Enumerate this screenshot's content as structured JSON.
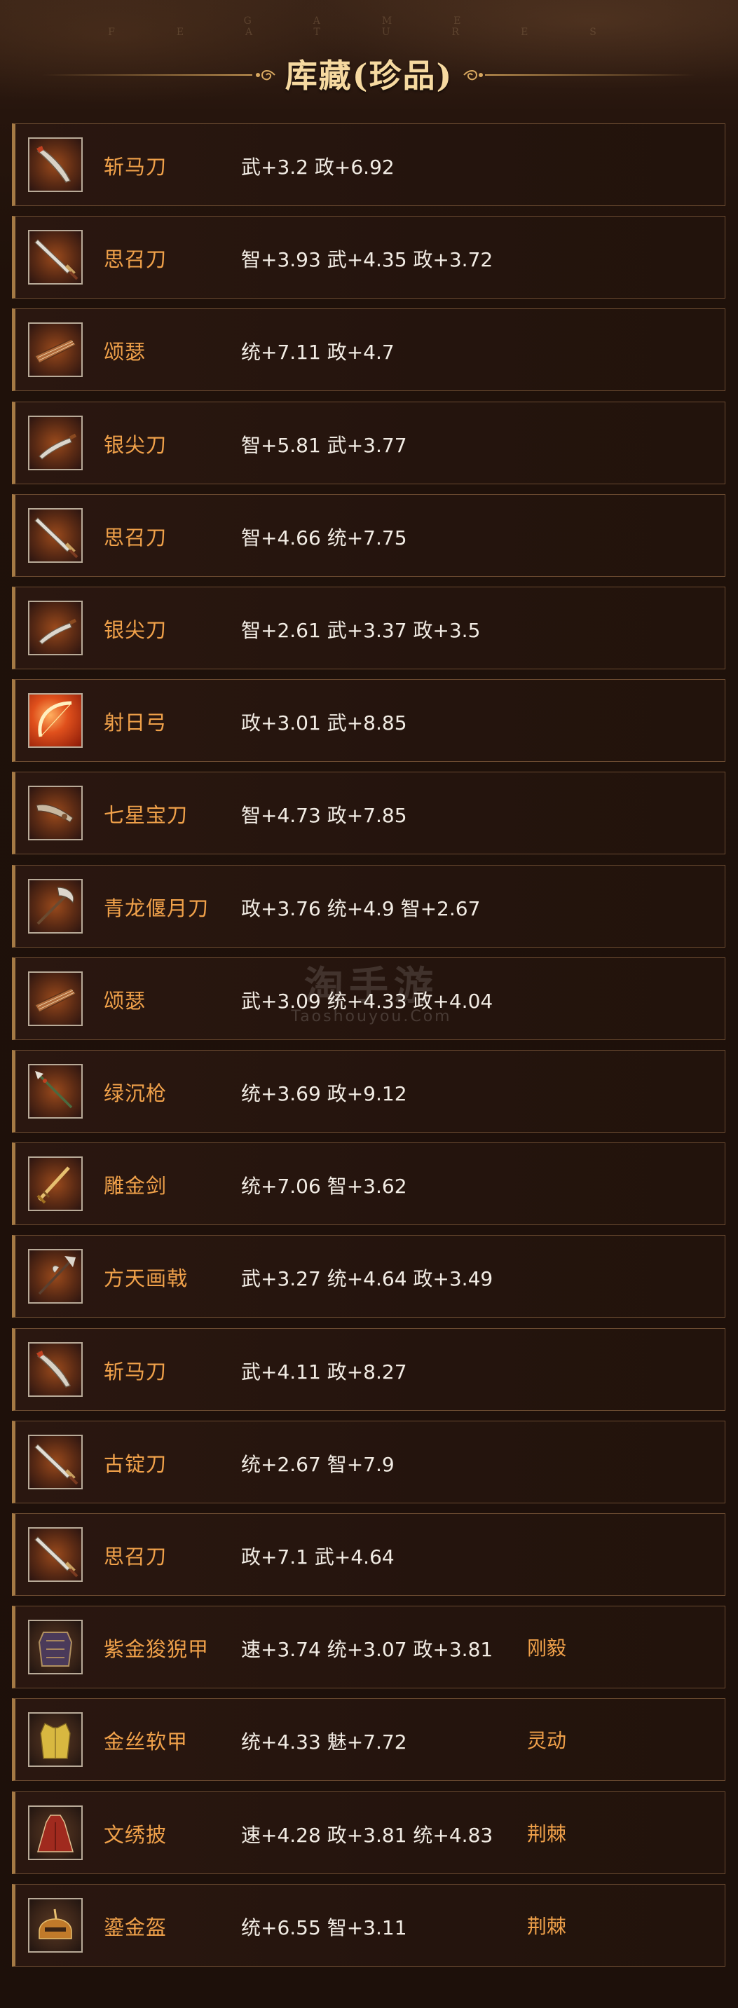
{
  "header": {
    "subtitle": "GAME FEATURES",
    "title": "库藏(珍品)"
  },
  "watermark": {
    "cn": "淘手游",
    "en": "Taoshouyou.Com"
  },
  "items": [
    {
      "name": "斩马刀",
      "stats": "武+3.2 政+6.92",
      "trait": "",
      "icon": "blade-icon"
    },
    {
      "name": "思召刀",
      "stats": "智+3.93 武+4.35 政+3.72",
      "trait": "",
      "icon": "sword-icon"
    },
    {
      "name": "颂瑟",
      "stats": "统+7.11 政+4.7",
      "trait": "",
      "icon": "zither-icon"
    },
    {
      "name": "银尖刀",
      "stats": "智+5.81 武+3.77",
      "trait": "",
      "icon": "dagger-icon"
    },
    {
      "name": "思召刀",
      "stats": "智+4.66 统+7.75",
      "trait": "",
      "icon": "sword-icon"
    },
    {
      "name": "银尖刀",
      "stats": "智+2.61 武+3.37 政+3.5",
      "trait": "",
      "icon": "dagger-icon"
    },
    {
      "name": "射日弓",
      "stats": "政+3.01 武+8.85",
      "trait": "",
      "icon": "bow-icon"
    },
    {
      "name": "七星宝刀",
      "stats": "智+4.73 政+7.85",
      "trait": "",
      "icon": "dragon-blade-icon"
    },
    {
      "name": "青龙偃月刀",
      "stats": "政+3.76 统+4.9 智+2.67",
      "trait": "",
      "icon": "glaive-icon"
    },
    {
      "name": "颂瑟",
      "stats": "武+3.09 统+4.33 政+4.04",
      "trait": "",
      "icon": "zither-icon"
    },
    {
      "name": "绿沉枪",
      "stats": "统+3.69 政+9.12",
      "trait": "",
      "icon": "spear-icon"
    },
    {
      "name": "雕金剑",
      "stats": "统+7.06 智+3.62",
      "trait": "",
      "icon": "gold-sword-icon"
    },
    {
      "name": "方天画戟",
      "stats": "武+3.27 统+4.64 政+3.49",
      "trait": "",
      "icon": "halberd-icon"
    },
    {
      "name": "斩马刀",
      "stats": "武+4.11 政+8.27",
      "trait": "",
      "icon": "blade-icon"
    },
    {
      "name": "古锭刀",
      "stats": "统+2.67 智+7.9",
      "trait": "",
      "icon": "sword-icon"
    },
    {
      "name": "思召刀",
      "stats": "政+7.1 武+4.64",
      "trait": "",
      "icon": "sword-icon"
    },
    {
      "name": "紫金狻猊甲",
      "stats": "速+3.74 统+3.07 政+3.81",
      "trait": "刚毅",
      "icon": "armor-icon"
    },
    {
      "name": "金丝软甲",
      "stats": "统+4.33 魅+7.72",
      "trait": "灵动",
      "icon": "vest-icon"
    },
    {
      "name": "文绣披",
      "stats": "速+4.28 政+3.81 统+4.83",
      "trait": "荆棘",
      "icon": "cloak-icon"
    },
    {
      "name": "鎏金盔",
      "stats": "统+6.55 智+3.11",
      "trait": "荆棘",
      "icon": "helmet-icon"
    }
  ]
}
